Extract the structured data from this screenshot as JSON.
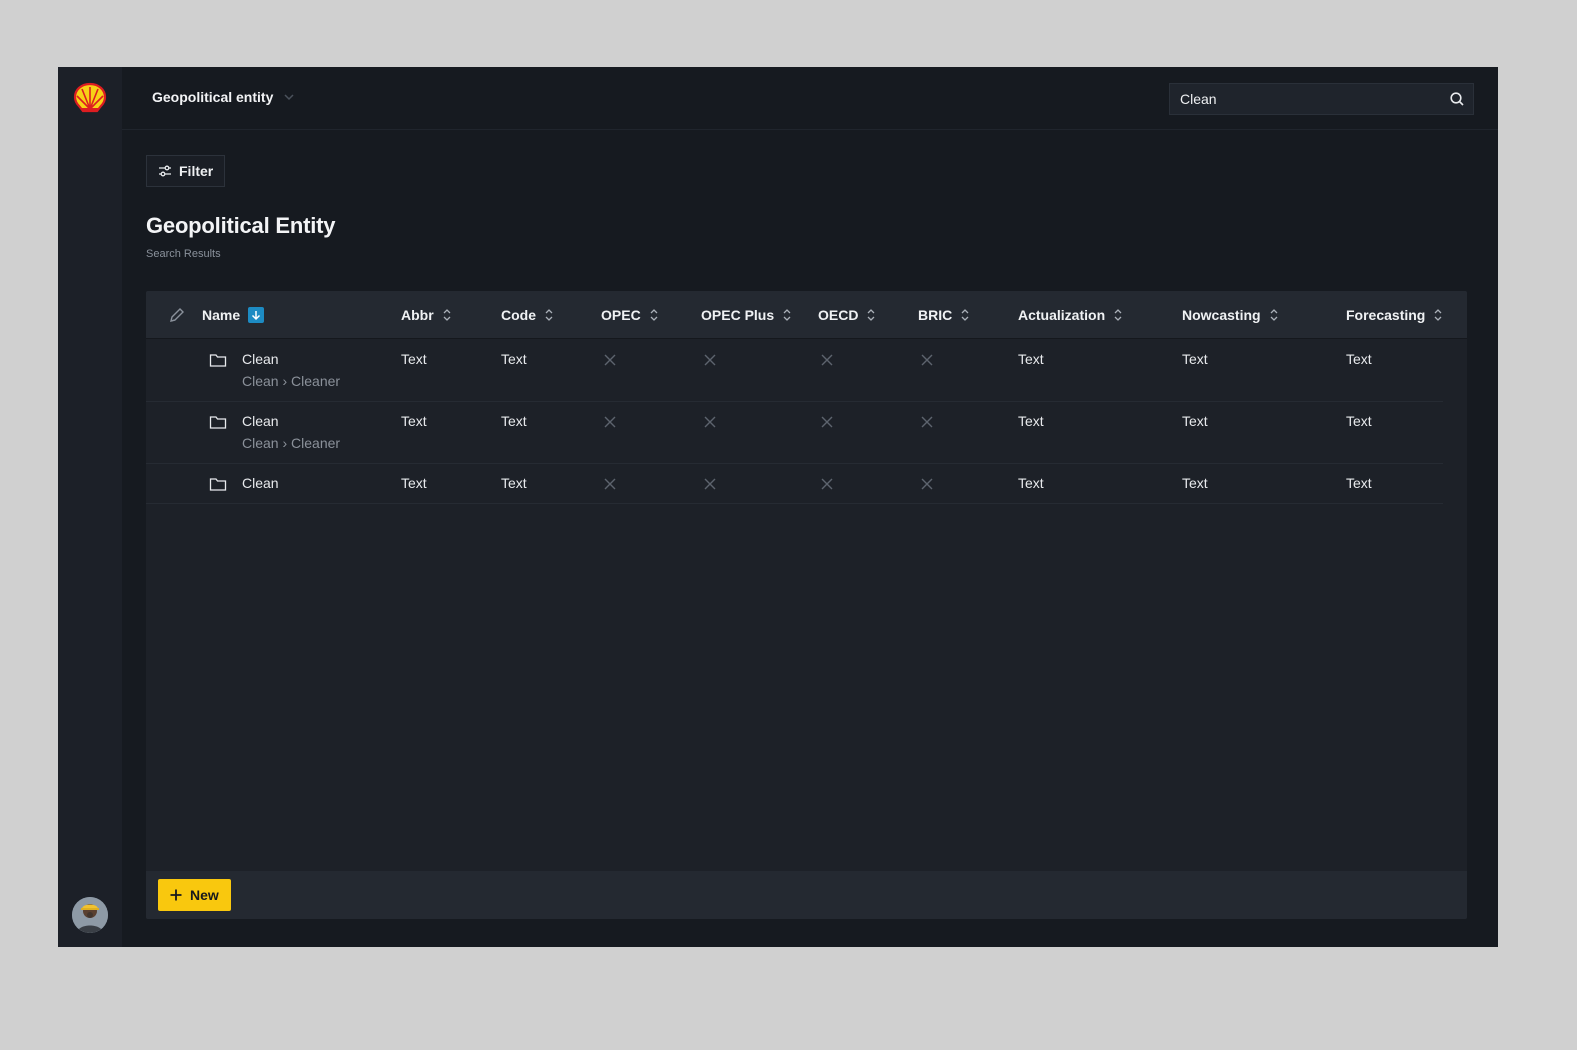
{
  "header": {
    "entity_select_label": "Geopolitical entity",
    "search_value": "Clean"
  },
  "toolbar": {
    "filter_label": "Filter"
  },
  "page": {
    "title": "Geopolitical Entity",
    "subtitle": "Search Results"
  },
  "table": {
    "columns": [
      "Name",
      "Abbr",
      "Code",
      "OPEC",
      "OPEC Plus",
      "OECD",
      "BRIC",
      "Actualization",
      "Nowcasting",
      "Forecasting"
    ],
    "sorted_column": "Name",
    "rows": [
      {
        "name": "Clean",
        "path": "Clean › Cleaner",
        "abbr": "Text",
        "code": "Text",
        "opec": false,
        "opec_plus": false,
        "oecd": false,
        "bric": false,
        "actualization": "Text",
        "nowcasting": "Text",
        "forecasting": "Text"
      },
      {
        "name": "Clean",
        "path": "Clean ›  Cleaner",
        "abbr": "Text",
        "code": "Text",
        "opec": false,
        "opec_plus": false,
        "oecd": false,
        "bric": false,
        "actualization": "Text",
        "nowcasting": "Text",
        "forecasting": "Text"
      },
      {
        "name": "Clean",
        "path": "",
        "abbr": "Text",
        "code": "Text",
        "opec": false,
        "opec_plus": false,
        "oecd": false,
        "bric": false,
        "actualization": "Text",
        "nowcasting": "Text",
        "forecasting": "Text"
      }
    ]
  },
  "footer": {
    "new_label": "New"
  },
  "colors": {
    "accent": "#f9c80e",
    "sort_active": "#1d8bc3",
    "background": "#161a20"
  },
  "icons": [
    "shell-logo-icon",
    "chevron-down-icon",
    "search-icon",
    "filter-sliders-icon",
    "edit-pencil-icon",
    "sort-arrow-down-icon",
    "sort-icon",
    "folder-icon",
    "x-mark-icon",
    "plus-icon",
    "avatar"
  ]
}
